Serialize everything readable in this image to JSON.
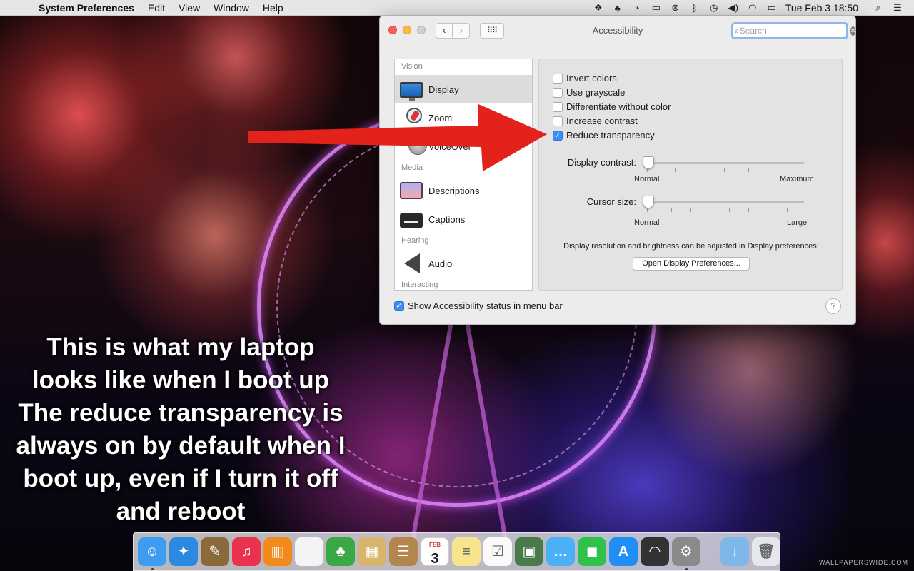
{
  "menubar": {
    "app_name": "System Preferences",
    "menus": [
      "Edit",
      "View",
      "Window",
      "Help"
    ],
    "clock": "Tue Feb 3  18:50",
    "status_icons": [
      "dropbox-icon",
      "evernote-icon",
      "disk-icon",
      "airplay-icon",
      "accessibility-icon",
      "bluetooth-icon",
      "time-machine-icon",
      "volume-icon",
      "wifi-icon",
      "battery-icon"
    ]
  },
  "window": {
    "title": "Accessibility",
    "search_placeholder": "Search",
    "sidebar": {
      "vision_header": "Vision",
      "media_header": "Media",
      "hearing_header": "Hearing",
      "interacting_header": "Interacting",
      "items": [
        {
          "label": "Display",
          "icon": "display-icon",
          "selected": true
        },
        {
          "label": "Zoom",
          "icon": "zoom-icon",
          "selected": false
        },
        {
          "label": "VoiceOver",
          "icon": "voiceover-icon",
          "selected": false
        },
        {
          "label": "Descriptions",
          "icon": "descriptions-icon",
          "selected": false
        },
        {
          "label": "Captions",
          "icon": "captions-icon",
          "selected": false
        },
        {
          "label": "Audio",
          "icon": "audio-icon",
          "selected": false
        }
      ]
    },
    "options": [
      {
        "label": "Invert colors",
        "checked": false
      },
      {
        "label": "Use grayscale",
        "checked": false
      },
      {
        "label": "Differentiate without color",
        "checked": false
      },
      {
        "label": "Increase contrast",
        "checked": false
      },
      {
        "label": "Reduce transparency",
        "checked": true
      }
    ],
    "display_contrast": {
      "label": "Display contrast:",
      "min_label": "Normal",
      "max_label": "Maximum",
      "value": 0
    },
    "cursor_size": {
      "label": "Cursor size:",
      "min_label": "Normal",
      "max_label": "Large",
      "value": 0
    },
    "note": "Display resolution and brightness can be adjusted in Display preferences:",
    "open_button": "Open Display Preferences...",
    "status_checkbox": {
      "label": "Show Accessibility status in menu bar",
      "checked": true
    },
    "help": "?"
  },
  "caption_lines": [
    "This is what my laptop",
    "looks like when I boot up",
    "The reduce transparency is",
    "always on by default when I",
    "boot up, even if I turn it off",
    "and reboot"
  ],
  "dock": {
    "calendar_month": "FEB",
    "calendar_day": "3",
    "apps": [
      {
        "icon": "finder-icon",
        "color": "#3d9bf0",
        "running": true
      },
      {
        "icon": "safari-icon",
        "color": "#2b8ae0",
        "running": false
      },
      {
        "icon": "preview-photo-icon",
        "color": "#8a6a3a",
        "running": false
      },
      {
        "icon": "itunes-icon",
        "color": "#e8324e",
        "running": false
      },
      {
        "icon": "ibooks-icon",
        "color": "#f18a1a",
        "running": false
      },
      {
        "icon": "textedit-icon",
        "color": "#f4f4f4",
        "running": false
      },
      {
        "icon": "evernote-icon",
        "color": "#39a845",
        "running": false
      },
      {
        "icon": "preview-icon",
        "color": "#d9b56b",
        "running": false
      },
      {
        "icon": "contacts-icon",
        "color": "#b3864d",
        "running": false
      },
      {
        "icon": "calendar-icon",
        "color": "#ffffff",
        "running": false
      },
      {
        "icon": "notes-icon",
        "color": "#f6e58d",
        "running": false
      },
      {
        "icon": "reminders-icon",
        "color": "#fafafa",
        "running": false
      },
      {
        "icon": "iphoto-icon",
        "color": "#4a7a4a",
        "running": false
      },
      {
        "icon": "messages-icon",
        "color": "#4cb0f7",
        "running": false
      },
      {
        "icon": "facetime-icon",
        "color": "#2fc24a",
        "running": false
      },
      {
        "icon": "app-store-icon",
        "color": "#1f8ef5",
        "running": false
      },
      {
        "icon": "airport-utility-icon",
        "color": "#333333",
        "running": false
      },
      {
        "icon": "system-preferences-icon",
        "color": "#8a8a8a",
        "running": true
      },
      {
        "icon": "downloads-icon",
        "color": "#7fb8e8",
        "running": false
      },
      {
        "icon": "trash-icon",
        "color": "#e4e8ec",
        "running": false
      }
    ]
  },
  "watermark": "WALLPAPERSWIDE.COM",
  "colors": {
    "accent": "#3b8ef5",
    "arrow": "#e3221b"
  }
}
